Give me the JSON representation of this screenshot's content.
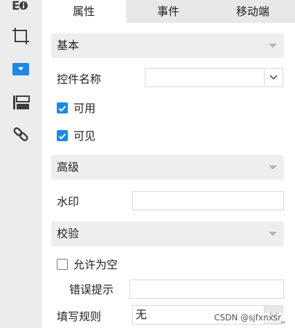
{
  "sidebar": {
    "items": [
      {
        "icon": "info-icon",
        "active": false
      },
      {
        "icon": "crop-frame-icon",
        "active": false
      },
      {
        "icon": "dropdown-widget-icon",
        "active": true
      },
      {
        "icon": "layout-panel-icon",
        "active": false
      },
      {
        "icon": "link-icon",
        "active": false
      }
    ],
    "accent": "#1e88e5"
  },
  "tabs": [
    {
      "label": "属性",
      "active": true
    },
    {
      "label": "事件",
      "active": false
    },
    {
      "label": "移动端",
      "active": false
    }
  ],
  "sections": {
    "basic": {
      "title": "基本"
    },
    "advanced": {
      "title": "高级"
    },
    "validation": {
      "title": "校验"
    }
  },
  "fields": {
    "widget_name": {
      "label": "控件名称",
      "value": ""
    },
    "enabled": {
      "label": "可用",
      "checked": true
    },
    "visible": {
      "label": "可见",
      "checked": true
    },
    "watermark": {
      "label": "水印",
      "value": ""
    },
    "allow_empty": {
      "label": "允许为空",
      "checked": false
    },
    "error_hint": {
      "label": "错误提示",
      "value": ""
    },
    "fill_rule": {
      "label": "填写规则",
      "value": "无"
    }
  },
  "overlay": {
    "text": "CSDN @sjfxnxsr_"
  }
}
